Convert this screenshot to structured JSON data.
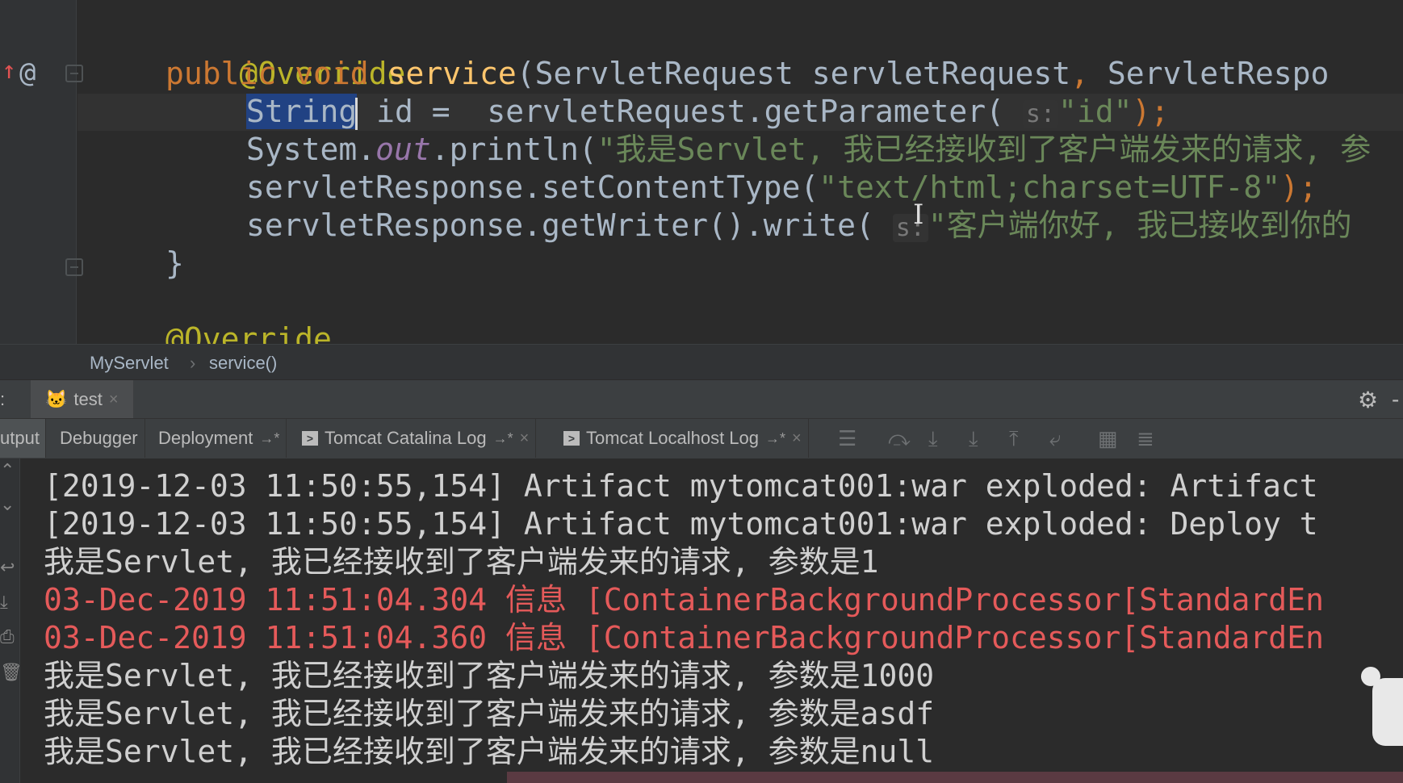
{
  "editor": {
    "code_lines": [
      {
        "anno": "@Override"
      },
      {
        "kw1": "public",
        "kw2": "void",
        "fn": "service",
        "rest": "(ServletRequest servletRequest",
        "comma": ",",
        "rest2": " ServletRespo"
      },
      {
        "type": "String",
        "rest": " id =  servletRequest.getParameter(",
        "hint": "s:",
        "str": "\"id\"",
        "end": ");"
      },
      {
        "prefix": "System.",
        "italic": "out",
        "rest": ".println(",
        "str": "\"我是Servlet, 我已经接收到了客户端发来的请求, 参"
      },
      {
        "rest": "servletResponse.setContentType(",
        "str": "\"text/html;charset=UTF-8\"",
        "end": ");"
      },
      {
        "rest": "servletResponse.getWriter().write(",
        "hint": "s:",
        "str": "\"客户端你好, 我已接收到你的"
      },
      {
        "rest": "}"
      },
      {
        "anno": "@Override"
      }
    ],
    "gutter_override_marker": "↑",
    "gutter_at_marker": "@"
  },
  "breadcrumb": {
    "items": [
      "MyServlet",
      "service()"
    ],
    "separator": "›"
  },
  "run_panel": {
    "left_label": ":",
    "config_tab": "test",
    "close": "×",
    "settings_icon": "gear-icon",
    "settings_glyph": "⚙",
    "right_glyph": "-"
  },
  "console_tabs": [
    {
      "label": "utput",
      "active": true
    },
    {
      "label": "Debugger"
    },
    {
      "label": "Deployment",
      "pin": "→*"
    },
    {
      "label": "Tomcat Catalina Log",
      "pin": "→*",
      "close": "×",
      "icon": ">"
    },
    {
      "label": "Tomcat Localhost Log",
      "pin": "→*",
      "close": "×",
      "icon": ">"
    }
  ],
  "console": {
    "lines": [
      {
        "text": "[2019-12-03 11:50:55,154] Artifact mytomcat001:war exploded: Artifact",
        "type": "info"
      },
      {
        "text": "[2019-12-03 11:50:55,154] Artifact mytomcat001:war exploded: Deploy t",
        "type": "info"
      },
      {
        "text": "我是Servlet, 我已经接收到了客户端发来的请求, 参数是1",
        "type": "info"
      },
      {
        "text": "03-Dec-2019 11:51:04.304 信息 [ContainerBackgroundProcessor[StandardEn",
        "type": "err"
      },
      {
        "text": "03-Dec-2019 11:51:04.360 信息 [ContainerBackgroundProcessor[StandardEn",
        "type": "err"
      },
      {
        "text": "我是Servlet, 我已经接收到了客户端发来的请求, 参数是1000",
        "type": "info"
      },
      {
        "text": "我是Servlet, 我已经接收到了客户端发来的请求, 参数是asdf",
        "type": "info"
      },
      {
        "text": "我是Servlet, 我已经接收到了客户端发来的请求, 参数是null",
        "type": "info"
      }
    ]
  },
  "colors": {
    "keyword": "#cc7832",
    "string": "#6a8759",
    "annotation": "#bbb529",
    "error": "#e55a5a",
    "selection": "#214283"
  }
}
